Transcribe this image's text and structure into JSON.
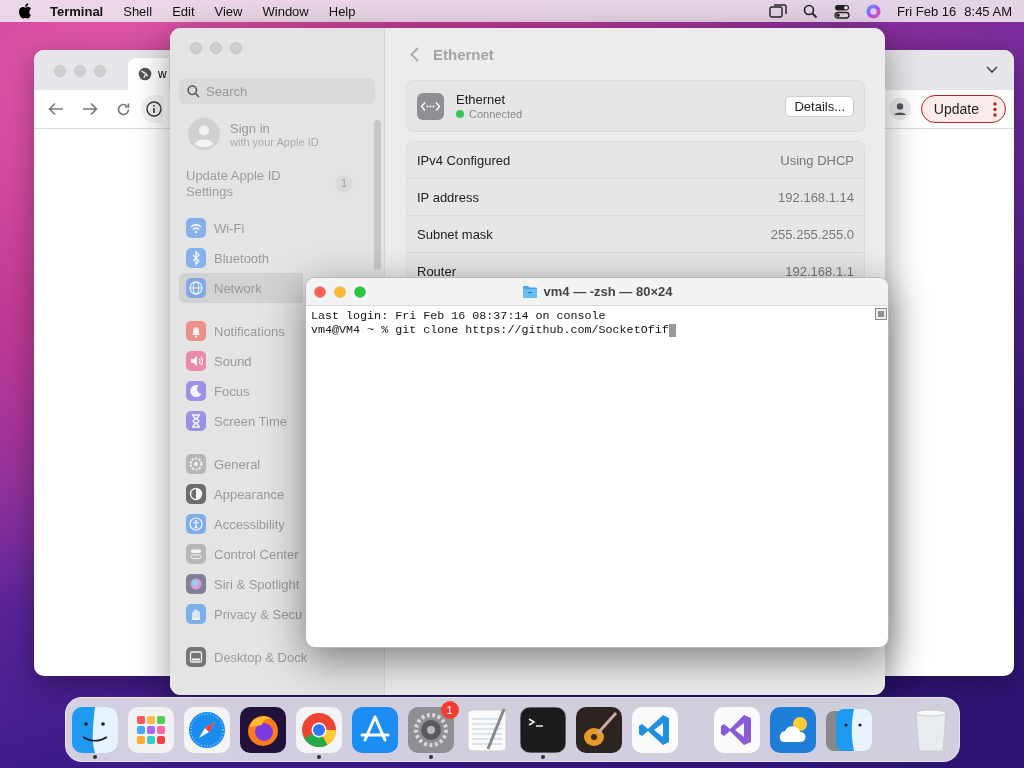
{
  "menu_bar": {
    "app": "Terminal",
    "menus": [
      "Shell",
      "Edit",
      "View",
      "Window",
      "Help"
    ],
    "date": "Fri Feb 16",
    "time": "8:45 AM"
  },
  "browser": {
    "tab_title": "w",
    "update_button": "Update"
  },
  "settings": {
    "search_placeholder": "Search",
    "account": {
      "title": "Sign in",
      "subtitle": "with your Apple ID"
    },
    "notice": {
      "label": "Update Apple ID Settings",
      "count": "1"
    },
    "sidebar": [
      {
        "items": [
          {
            "kind": "wifi",
            "label": "Wi-Fi",
            "selected": false
          },
          {
            "kind": "bluetooth",
            "label": "Bluetooth",
            "selected": false
          },
          {
            "kind": "network",
            "label": "Network",
            "selected": true
          }
        ]
      },
      {
        "items": [
          {
            "kind": "notifications",
            "label": "Notifications",
            "selected": false
          },
          {
            "kind": "sound",
            "label": "Sound",
            "selected": false
          },
          {
            "kind": "focus",
            "label": "Focus",
            "selected": false
          },
          {
            "kind": "screentime",
            "label": "Screen Time",
            "selected": false
          }
        ]
      },
      {
        "items": [
          {
            "kind": "general",
            "label": "General",
            "selected": false
          },
          {
            "kind": "appearance",
            "label": "Appearance",
            "selected": false
          },
          {
            "kind": "accessibility",
            "label": "Accessibility",
            "selected": false
          },
          {
            "kind": "controlcenter",
            "label": "Control Center",
            "selected": false
          },
          {
            "kind": "siri",
            "label": "Siri & Spotlight",
            "selected": false
          },
          {
            "kind": "privacy",
            "label": "Privacy & Secu",
            "selected": false
          }
        ]
      },
      {
        "items": [
          {
            "kind": "desktop",
            "label": "Desktop & Dock",
            "selected": false
          }
        ]
      }
    ],
    "header": "Ethernet",
    "interface": {
      "name": "Ethernet",
      "status": "Connected",
      "color": "#34c759",
      "button": "Details..."
    },
    "rows": [
      {
        "label": "IPv4 Configured",
        "value": "Using DHCP"
      },
      {
        "label": "IP address",
        "value": "192.168.1.14"
      },
      {
        "label": "Subnet mask",
        "value": "255.255.255.0"
      },
      {
        "label": "Router",
        "value": "192.168.1.1"
      }
    ]
  },
  "terminal": {
    "title": "vm4 — -zsh — 80×24",
    "lines": [
      "Last login: Fri Feb 16 08:37:14 on console",
      "vm4@VM4 ~ % git clone https://github.com/SocketOfif"
    ]
  },
  "dock": {
    "groups": [
      {
        "items": [
          {
            "kind": "finder",
            "running": true
          },
          {
            "kind": "launchpad",
            "running": false
          },
          {
            "kind": "safari",
            "running": false
          },
          {
            "kind": "firefox",
            "running": false
          },
          {
            "kind": "chrome",
            "running": true
          },
          {
            "kind": "appstore",
            "running": false
          },
          {
            "kind": "settings",
            "running": true,
            "badge": "1"
          },
          {
            "kind": "textedit",
            "running": false
          },
          {
            "kind": "terminal",
            "running": true
          },
          {
            "kind": "garageband",
            "running": false
          },
          {
            "kind": "vscode",
            "running": false
          }
        ]
      },
      {
        "items": [
          {
            "kind": "visualstudio",
            "running": false
          },
          {
            "kind": "weather",
            "running": false
          },
          {
            "kind": "migration",
            "running": false
          }
        ]
      },
      {
        "items": [
          {
            "kind": "trash",
            "running": false
          }
        ]
      }
    ]
  }
}
